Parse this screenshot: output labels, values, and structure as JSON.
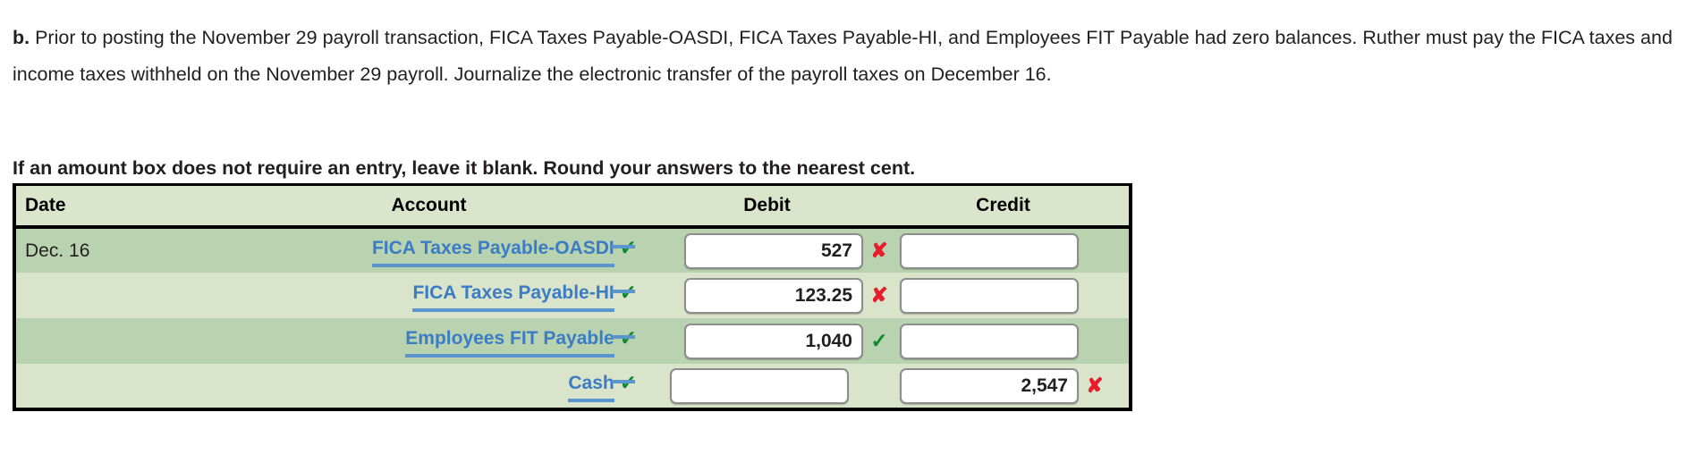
{
  "problem": {
    "label": "b.",
    "text": "Prior to posting the November 29 payroll transaction, FICA Taxes Payable-OASDI, FICA Taxes Payable-HI, and Employees FIT Payable had zero balances. Ruther must pay the FICA taxes and income taxes withheld on the November 29 payroll. Journalize the electronic transfer of the payroll taxes on December 16."
  },
  "instruction": "If an amount box does not require an entry, leave it blank. Round your answers to the nearest cent.",
  "table": {
    "headers": {
      "date": "Date",
      "account": "Account",
      "debit": "Debit",
      "credit": "Credit"
    },
    "rows": [
      {
        "date": "Dec. 16",
        "account": "FICA Taxes Payable-OASDI",
        "account_mark": "✓",
        "debit": "527",
        "debit_mark": "✘",
        "debit_mark_type": "x",
        "credit": "",
        "credit_mark": "",
        "credit_mark_type": "none"
      },
      {
        "date": "",
        "account": "FICA Taxes Payable-HI",
        "account_mark": "✓",
        "debit": "123.25",
        "debit_mark": "✘",
        "debit_mark_type": "x",
        "credit": "",
        "credit_mark": "",
        "credit_mark_type": "none"
      },
      {
        "date": "",
        "account": "Employees FIT Payable",
        "account_mark": "✓",
        "debit": "1,040",
        "debit_mark": "✓",
        "debit_mark_type": "ok",
        "credit": "",
        "credit_mark": "",
        "credit_mark_type": "none"
      },
      {
        "date": "",
        "account": "Cash",
        "account_mark": "✓",
        "debit": "",
        "debit_mark": "",
        "debit_mark_type": "none",
        "credit": "2,547",
        "credit_mark": "✘",
        "credit_mark_type": "x"
      }
    ]
  },
  "colors": {
    "row_dark": "#b9d3b0",
    "row_light": "#d9e4cb",
    "header_bg": "#dbe5cb",
    "link": "#3b7cc4",
    "check": "#118a2e",
    "cross": "#e81c2a"
  }
}
